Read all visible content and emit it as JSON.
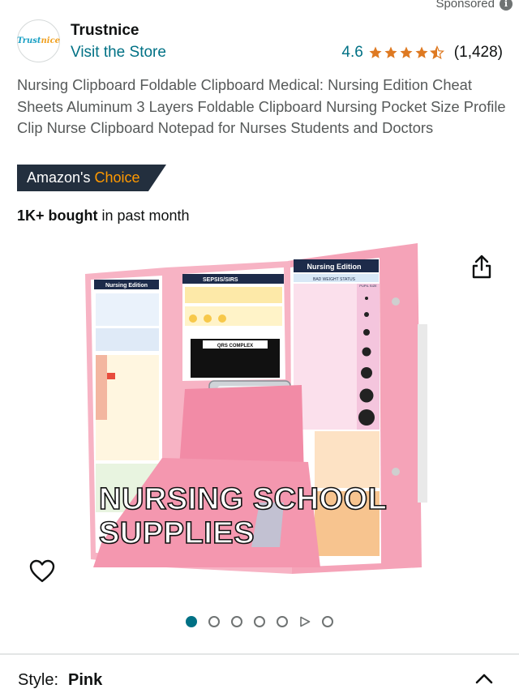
{
  "sponsored": {
    "label": "Sponsored"
  },
  "brand": {
    "name": "Trustnice",
    "logo_text_a": "Trust",
    "logo_text_b": "nice",
    "visit_store": "Visit the Store"
  },
  "rating": {
    "value": "4.6",
    "stars": 4.5,
    "count": "(1,428)",
    "star_color": "#de7921"
  },
  "product": {
    "title": "Nursing Clipboard Foldable Clipboard Medical: Nursing Edition Cheat Sheets Aluminum 3 Layers Foldable Clipboard Nursing Pocket Size Profile Clip Nurse Clipboard Notepad for Nurses Students and Doctors"
  },
  "badge": {
    "text_a": "Amazon's",
    "text_b": "Choice"
  },
  "bought": {
    "bold": "1K+ bought",
    "rest": " in past month"
  },
  "image": {
    "overlay_line1": "NURSING SCHOOL",
    "overlay_line2": "SUPPLIES",
    "left_panel_header": "Nursing Edition",
    "middle_panel_header": "SEPSIS/SIRS",
    "middle_panel_sub": "QRS COMPLEX",
    "right_panel_header": "Nursing Edition",
    "right_panel_sub": "BAD WEIGHT STATUS",
    "right_panel_col": "PUPIL SIZE",
    "clipboard_color": "#f28ba6"
  },
  "carousel": {
    "count": 7,
    "active_index": 0,
    "video_index": 5
  },
  "style": {
    "label": "Style:",
    "value": "Pink"
  }
}
